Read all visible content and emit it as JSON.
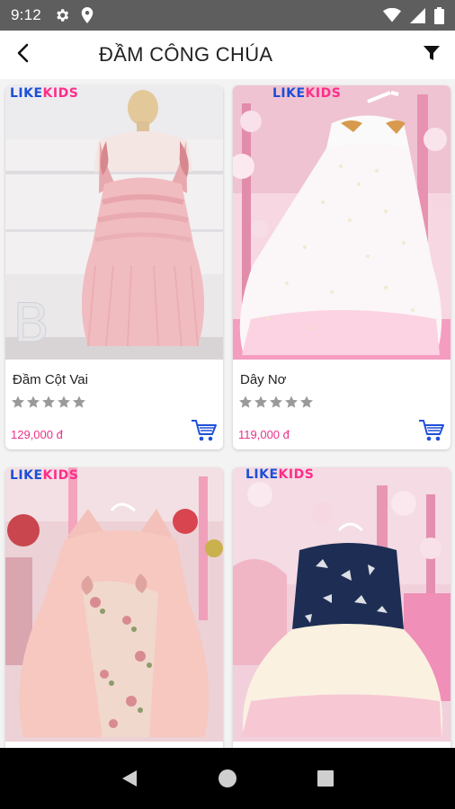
{
  "status_bar": {
    "time": "9:12",
    "icons": [
      "gear-icon",
      "location-icon",
      "wifi-icon",
      "signal-icon",
      "battery-icon"
    ]
  },
  "header": {
    "title": "ĐẦM CÔNG CHÚA",
    "back_icon": "chevron-left-icon",
    "filter_icon": "filter-icon"
  },
  "brand": {
    "part1": "LIKE",
    "part2": "KIDS"
  },
  "products": [
    {
      "name": "Đầm Cột Vai",
      "price": "129,000 đ",
      "rating": 0,
      "max_rating": 5,
      "image": "pink-tulle-dress-photo"
    },
    {
      "name": "Dây Nơ",
      "price": "119,000 đ",
      "rating": 0,
      "max_rating": 5,
      "image": "white-floral-dress-photo"
    },
    {
      "name": "",
      "price": "",
      "rating": 0,
      "max_rating": 5,
      "image": "pink-flower-dress-photo"
    },
    {
      "name": "",
      "price": "",
      "rating": 0,
      "max_rating": 5,
      "image": "navy-cream-dress-photo"
    }
  ],
  "colors": {
    "status_bar": "#5e5e5e",
    "price": "#e8338a",
    "star": "#9a9a9a",
    "cart": "#1f4fd8",
    "brand_blue": "#1b4fd6",
    "brand_pink": "#ff2d8a"
  },
  "nav": {
    "icons": [
      "back-triangle-icon",
      "home-circle-icon",
      "recents-square-icon"
    ]
  }
}
